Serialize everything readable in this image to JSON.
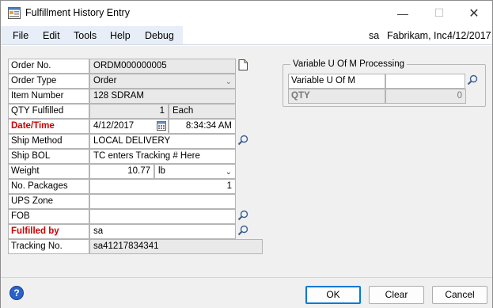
{
  "window": {
    "title": "Fulfillment History Entry"
  },
  "menu": {
    "items": [
      "File",
      "Edit",
      "Tools",
      "Help",
      "Debug"
    ],
    "user": "sa",
    "company": "Fabrikam, Inc.",
    "date": "4/12/2017"
  },
  "form": {
    "order_no": {
      "label": "Order No.",
      "value": "ORDM000000005"
    },
    "order_type": {
      "label": "Order Type",
      "value": "Order"
    },
    "item_number": {
      "label": "Item Number",
      "value": "128 SDRAM"
    },
    "qty_fulfilled": {
      "label": "QTY Fulfilled",
      "value": "1",
      "uom": "Each"
    },
    "date_time": {
      "label": "Date/Time",
      "date": "4/12/2017",
      "time": "8:34:34 AM"
    },
    "ship_method": {
      "label": "Ship Method",
      "value": "LOCAL DELIVERY"
    },
    "ship_bol": {
      "label": "Ship BOL",
      "value": "TC enters Tracking # Here"
    },
    "weight": {
      "label": "Weight",
      "value": "10.77",
      "unit": "lb"
    },
    "no_packages": {
      "label": "No. Packages",
      "value": "1"
    },
    "ups_zone": {
      "label": "UPS Zone",
      "value": ""
    },
    "fob": {
      "label": "FOB",
      "value": ""
    },
    "fulfilled_by": {
      "label": "Fulfilled by",
      "value": "sa"
    },
    "tracking_no": {
      "label": "Tracking No.",
      "value": "sa41217834341"
    }
  },
  "uom_group": {
    "title": "Variable U Of M Processing",
    "variable_uom": {
      "label": "Variable U Of M",
      "value": ""
    },
    "qty": {
      "label": "QTY",
      "value": "0"
    }
  },
  "buttons": {
    "ok": "OK",
    "clear": "Clear",
    "cancel": "Cancel"
  },
  "colors": {
    "required_label": "#cc0000",
    "menu_bg": "#e7eef7",
    "form_bg": "#f0f0f0",
    "default_button_border": "#0078d7"
  },
  "icons": [
    "app-icon",
    "minimize-icon",
    "maximize-icon",
    "close-icon",
    "note-icon",
    "lookup-icon",
    "calendar-icon",
    "dropdown-icon",
    "help-icon"
  ]
}
